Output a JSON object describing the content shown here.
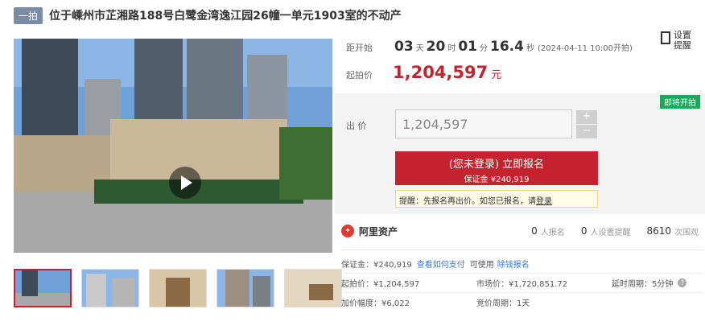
{
  "header": {
    "badge": "一拍",
    "title": "位于嵊州市芷湘路188号白鹭金湾逸江园26幢一单元1903室的不动产"
  },
  "countdown": {
    "label": "距开始",
    "days": "03",
    "days_unit": "天",
    "hours": "20",
    "hours_unit": "时",
    "minutes": "01",
    "minutes_unit": "分",
    "seconds": "16.4",
    "seconds_unit": "秒",
    "start_time": "(2024-04-11 10:00开拍)"
  },
  "start_price": {
    "label": "起拍价",
    "value": "1,204,597",
    "unit": "元"
  },
  "remind": {
    "label": "设置提醒",
    "icon": "phone-icon"
  },
  "bid": {
    "tag": "即将开拍",
    "label": "出  价",
    "value": "1,204,597",
    "plus": "+",
    "minus": "−",
    "apply_line1": "(您未登录) 立即报名",
    "apply_line2": "保证金 ¥240,919",
    "tip_prefix": "提醒：先报名再出价。如您已报名，请",
    "tip_link": "登录"
  },
  "stats": {
    "logo": "阿里资产",
    "registrants": "0",
    "registrants_label": "人报名",
    "reminders": "0",
    "reminders_label": "人设置提醒",
    "views": "8610",
    "views_label": "次围观"
  },
  "details": {
    "deposit": "保证金：¥240,919",
    "how_to_pay": "查看如何支付",
    "can_use": "可使用",
    "deduct": "除钱报名",
    "start_price": "起拍价：¥1,204,597",
    "market_price": "市场价：¥1,720,851.72",
    "delay": "延时周期：5分钟",
    "increment": "加价幅度：¥6,022",
    "period": "竞价周期：1天"
  },
  "colors": {
    "accent": "#c4222e",
    "tag": "#1ea65a",
    "badge": "#7a8ca6"
  }
}
